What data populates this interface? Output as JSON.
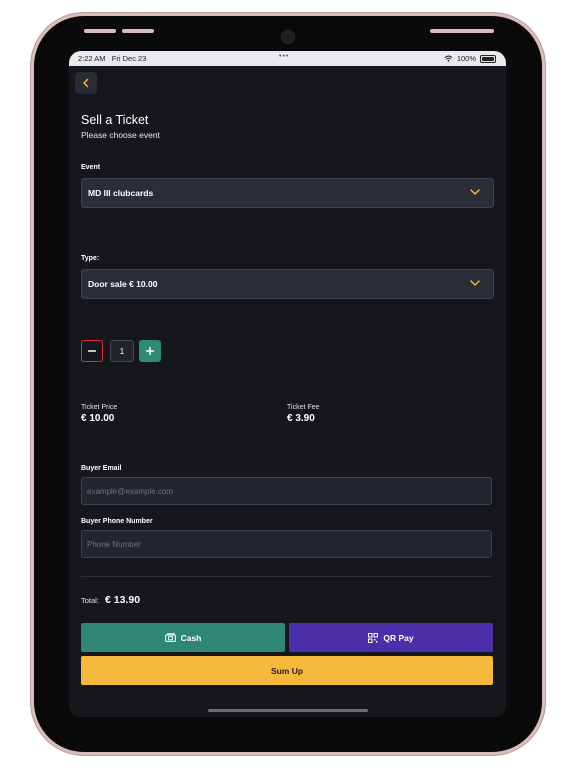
{
  "status_bar": {
    "time": "2:22 AM",
    "date": "Fri Dec 23",
    "battery": "100%"
  },
  "header": {
    "title": "Sell a Ticket",
    "subtitle": "Please choose event"
  },
  "event": {
    "label": "Event",
    "selected": "MD III clubcards"
  },
  "type": {
    "label": "Type:",
    "selected": "Door sale € 10.00"
  },
  "quantity": {
    "value": "1"
  },
  "pricing": {
    "ticket_price_label": "Ticket Price",
    "ticket_price_value": "€ 10.00",
    "ticket_fee_label": "Ticket Fee",
    "ticket_fee_value": "€ 3.90"
  },
  "buyer": {
    "email_label": "Buyer Email",
    "email_placeholder": "example@example.com",
    "email_value": "",
    "phone_label": "Buyer Phone Number",
    "phone_placeholder": "Phone Number",
    "phone_value": ""
  },
  "total": {
    "label": "Total:",
    "value": "€ 13.90"
  },
  "actions": {
    "cash_label": "Cash",
    "qr_label": "QR Pay",
    "sumup_label": "Sum Up"
  },
  "colors": {
    "accent": "#f6b93b",
    "cash": "#2e8674",
    "qr": "#4a2fa8",
    "minus_border": "#d8313a",
    "plus": "#2f8a73",
    "background": "#16171b"
  }
}
